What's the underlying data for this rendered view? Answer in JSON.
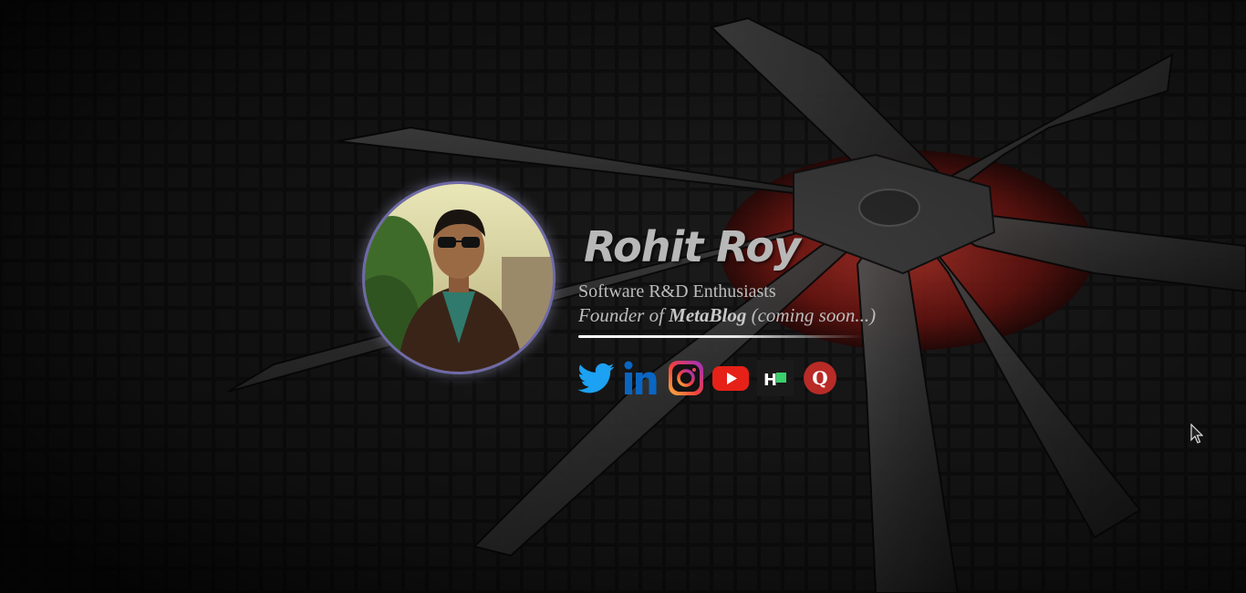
{
  "profile": {
    "name": "Rohit Roy",
    "tagline": "Software R&D Enthusiasts",
    "founder_prefix": "Founder of ",
    "founder_brand": "MetaBlog",
    "founder_suffix": " (coming soon...)"
  },
  "social_links": [
    {
      "label": "Twitter",
      "icon": "twitter-icon"
    },
    {
      "label": "LinkedIn",
      "icon": "linkedin-icon"
    },
    {
      "label": "Instagram",
      "icon": "instagram-icon"
    },
    {
      "label": "YouTube",
      "icon": "youtube-icon"
    },
    {
      "label": "HackerEarth",
      "icon": "hackerearth-icon",
      "text": "H"
    },
    {
      "label": "Quora",
      "icon": "quora-icon",
      "text": "Q"
    }
  ],
  "colors": {
    "background": "#0e0e0e",
    "text": "#bdbdbd",
    "twitter": "#1da1f2",
    "linkedin": "#0a66c2",
    "youtube": "#e62117",
    "quora": "#b92b27",
    "hackerearth_bg": "#1a1a1a",
    "hackerearth_accent": "#3ad06b"
  }
}
